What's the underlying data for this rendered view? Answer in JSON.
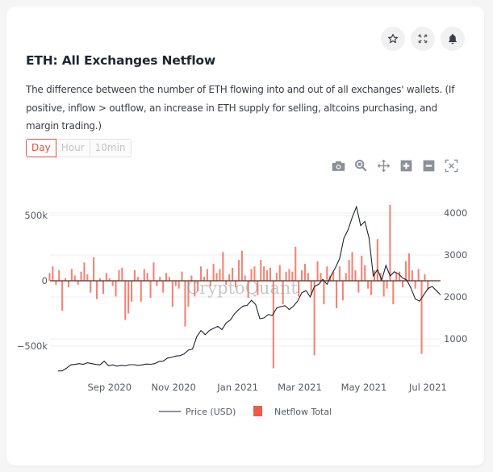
{
  "card": {
    "title": "ETH: All Exchanges Netflow",
    "description": "The difference between the number of ETH flowing into and out of all exchanges' wallets. (If positive, inflow > outflow, an increase in ETH supply for selling, altcoins purchasing, and margin trading.)",
    "actions": [
      {
        "name": "favorite",
        "icon": "star-icon"
      },
      {
        "name": "fullscreen",
        "icon": "expand-icon"
      },
      {
        "name": "alert",
        "icon": "bell-icon"
      }
    ],
    "intervals": [
      {
        "label": "Day",
        "active": true
      },
      {
        "label": "Hour",
        "active": false
      },
      {
        "label": "10min",
        "active": false
      }
    ],
    "modebar": [
      {
        "name": "download-png",
        "icon": "camera-icon"
      },
      {
        "name": "zoom",
        "icon": "zoom-icon"
      },
      {
        "name": "pan",
        "icon": "pan-icon"
      },
      {
        "name": "zoom-in",
        "icon": "plus-square-icon"
      },
      {
        "name": "zoom-out",
        "icon": "minus-square-icon"
      },
      {
        "name": "autoscale",
        "icon": "autoscale-icon"
      }
    ],
    "watermark": "CryptoQuant"
  },
  "colors": {
    "netflow": "#ef5b45",
    "price": "#1c2330",
    "accent": "#e0513f",
    "grid": "#ececec",
    "zeroline": "#5a2a22"
  },
  "chart_data": {
    "type": "bar",
    "title": "ETH: All Exchanges Netflow",
    "xlabel": "",
    "ylabel": "",
    "x_range": [
      "2020-07-01",
      "2021-07-13"
    ],
    "x_ticks": [
      {
        "date": "2020-09-01",
        "label": "Sep 2020"
      },
      {
        "date": "2020-11-01",
        "label": "Nov 2020"
      },
      {
        "date": "2021-01-01",
        "label": "Jan 2021"
      },
      {
        "date": "2021-03-01",
        "label": "Mar 2021"
      },
      {
        "date": "2021-05-01",
        "label": "May 2021"
      },
      {
        "date": "2021-07-01",
        "label": "Jul 2021"
      }
    ],
    "y_left": {
      "range": [
        -720000,
        620000
      ],
      "ticks": [
        {
          "v": 500000,
          "label": "500k"
        },
        {
          "v": 0,
          "label": "0"
        },
        {
          "v": -500000,
          "label": "−500k"
        }
      ]
    },
    "y_right": {
      "range": [
        0,
        4580
      ],
      "ticks": [
        {
          "v": 4000,
          "label": "4000"
        },
        {
          "v": 3000,
          "label": "3000"
        },
        {
          "v": 2000,
          "label": "2000"
        },
        {
          "v": 1000,
          "label": "1000"
        }
      ]
    },
    "grid": true,
    "legend": {
      "placement": "bottom-center",
      "entries": [
        {
          "name": "Price (USD)",
          "type": "line"
        },
        {
          "name": "Netflow Total",
          "type": "bar"
        }
      ]
    },
    "series": [
      {
        "name": "Netflow Total",
        "type": "bar",
        "axis": "left",
        "start": "2020-07-06",
        "step_days": 3,
        "values": [
          60000,
          110000,
          -30000,
          80000,
          -230000,
          20000,
          -50000,
          90000,
          40000,
          -30000,
          70000,
          140000,
          50000,
          -90000,
          180000,
          -140000,
          20000,
          -100000,
          60000,
          20000,
          -40000,
          -120000,
          80000,
          100000,
          -300000,
          -250000,
          -160000,
          80000,
          30000,
          -160000,
          90000,
          60000,
          -130000,
          140000,
          -40000,
          30000,
          -90000,
          60000,
          30000,
          -200000,
          -40000,
          -60000,
          70000,
          -350000,
          -200000,
          40000,
          -120000,
          -80000,
          110000,
          30000,
          90000,
          -40000,
          130000,
          60000,
          90000,
          220000,
          -30000,
          50000,
          100000,
          -50000,
          160000,
          230000,
          40000,
          -130000,
          90000,
          110000,
          -110000,
          160000,
          110000,
          80000,
          100000,
          -670000,
          60000,
          120000,
          -180000,
          70000,
          90000,
          70000,
          260000,
          -120000,
          80000,
          130000,
          60000,
          -110000,
          -570000,
          150000,
          60000,
          -180000,
          110000,
          40000,
          70000,
          -210000,
          110000,
          -150000,
          60000,
          160000,
          220000,
          80000,
          -90000,
          190000,
          120000,
          -60000,
          -110000,
          80000,
          320000,
          60000,
          -120000,
          -60000,
          580000,
          -180000,
          60000,
          70000,
          -50000,
          150000,
          210000,
          80000,
          -60000,
          90000,
          -560000,
          50000,
          -70000
        ]
      },
      {
        "name": "Price (USD)",
        "type": "line",
        "axis": "right",
        "start": "2020-07-14",
        "step_days": 4,
        "values": [
          235,
          238,
          300,
          380,
          390,
          410,
          395,
          430,
          410,
          390,
          380,
          470,
          360,
          380,
          350,
          370,
          360,
          385,
          385,
          370,
          380,
          400,
          395,
          410,
          460,
          470,
          540,
          560,
          590,
          600,
          640,
          730,
          760,
          1050,
          1200,
          1100,
          1200,
          1250,
          1300,
          1220,
          1380,
          1450,
          1600,
          1700,
          1780,
          1800,
          1920,
          1820,
          1480,
          1500,
          1580,
          1560,
          1730,
          1770,
          1790,
          1700,
          1780,
          1900,
          2100,
          2150,
          2000,
          2250,
          2300,
          2420,
          2300,
          2520,
          2700,
          2920,
          3400,
          3600,
          3900,
          4150,
          3700,
          3800,
          3400,
          2500,
          2650,
          2400,
          2750,
          2500,
          2600,
          2550,
          2450,
          2400,
          2200,
          1950,
          1900,
          2050,
          2200,
          2250,
          2150,
          2050
        ]
      }
    ]
  }
}
